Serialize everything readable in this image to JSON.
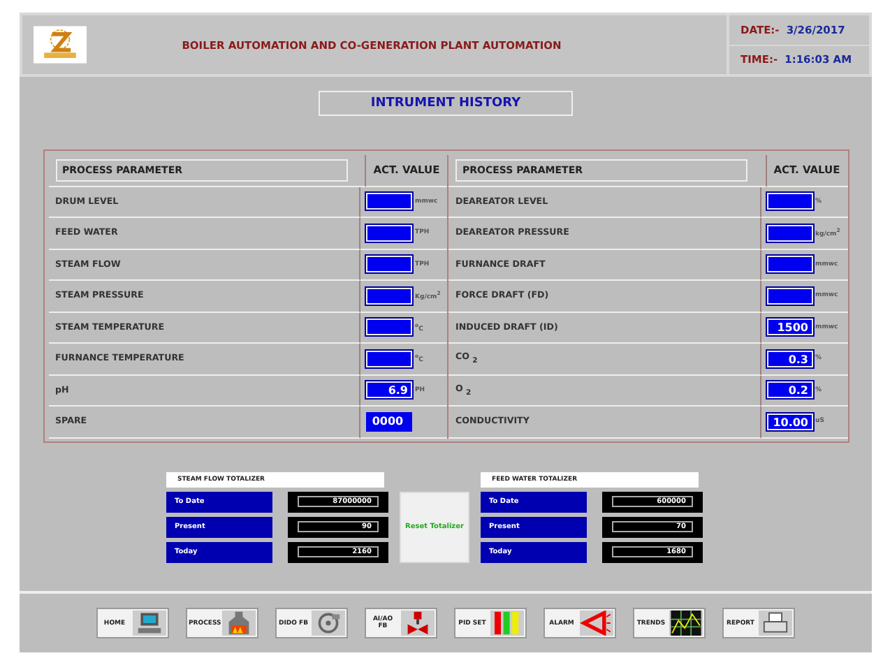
{
  "header": {
    "title": "BOILER AUTOMATION AND CO-GENERATION PLANT AUTOMATION",
    "date_label": "DATE:-",
    "date": "3/26/2017",
    "time_label": "TIME:-",
    "time": "1:16:03 AM"
  },
  "page_title": "INTRUMENT HISTORY",
  "tables": [
    {
      "param_heading": "PROCESS PARAMETER",
      "value_heading": "ACT. VALUE",
      "rows": [
        {
          "name": "DRUM LEVEL",
          "unit": "mmwc"
        },
        {
          "name": "FEED WATER",
          "unit": "TPH"
        },
        {
          "name": "STEAM FLOW",
          "unit": "TPH"
        },
        {
          "name": "STEAM PRESSURE",
          "unit": "Kg/cm$^{2}$"
        },
        {
          "name": "STEAM TEMPERATURE",
          "unit": "$^{o}$C"
        },
        {
          "name": "FURNANCE TEMPERATURE",
          "unit": "$^{o}$C"
        },
        {
          "name": "pH",
          "value": "6.9",
          "unit": "PH"
        },
        {
          "name": "SPARE",
          "value": "0000",
          "kind": "solid"
        }
      ]
    },
    {
      "param_heading": "PROCESS PARAMETER",
      "value_heading": "ACT. VALUE",
      "rows": [
        {
          "name": "DEAREATOR LEVEL",
          "unit": "%"
        },
        {
          "name": "DEAREATOR PRESSURE",
          "unit": "kg/cm$^{2}$"
        },
        {
          "name": "FURNANCE DRAFT",
          "unit": "mmwc"
        },
        {
          "name": "FORCE DRAFT (FD)",
          "unit": "mmwc"
        },
        {
          "name": "INDUCED DRAFT (ID)",
          "value": "1500",
          "unit": "mmwc"
        },
        {
          "name": "CO $_{2}$",
          "value": "0.3",
          "unit": "%"
        },
        {
          "name": "O $_{2}$",
          "value": "0.2",
          "unit": "%"
        },
        {
          "name": "CONDUCTIVITY",
          "value": "10.00",
          "unit": "uS"
        }
      ]
    }
  ],
  "totalizers": [
    {
      "title": "STEAM  FLOW  TOTALIZER",
      "rows": [
        {
          "label": "To Date",
          "value": "87000000"
        },
        {
          "label": "Present",
          "value": "90"
        },
        {
          "label": "Today",
          "value": "2160"
        }
      ]
    },
    {
      "title": "FEED  WATER  TOTALIZER",
      "rows": [
        {
          "label": "To Date",
          "value": "600000"
        },
        {
          "label": "Present",
          "value": "70"
        },
        {
          "label": "Today",
          "value": "1680"
        }
      ]
    }
  ],
  "reset_button": "Reset Totalizer",
  "nav": [
    {
      "label": "HOME"
    },
    {
      "label": "PROCESS"
    },
    {
      "label": "DIDO FB"
    },
    {
      "label": "AI/AO FB"
    },
    {
      "label": "PID SET"
    },
    {
      "label": "ALARM"
    },
    {
      "label": "TRENDS"
    },
    {
      "label": "REPORT"
    }
  ]
}
